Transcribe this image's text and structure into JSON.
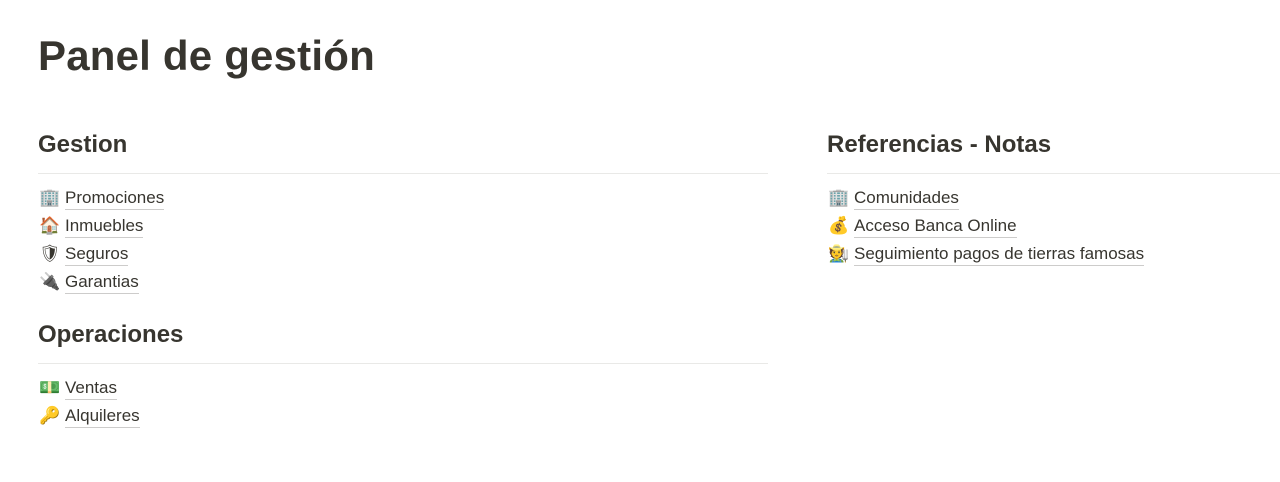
{
  "page": {
    "title": "Panel de gestión"
  },
  "left": {
    "sections": [
      {
        "heading": "Gestion",
        "items": [
          {
            "label": "Promociones",
            "icon": "office-building-icon",
            "glyph": "🏢"
          },
          {
            "label": "Inmuebles",
            "icon": "house-icon",
            "glyph": "🏠"
          },
          {
            "label": "Seguros",
            "icon": "shield-icon",
            "glyph": "🛡"
          },
          {
            "label": "Garantias",
            "icon": "plug-icon",
            "glyph": "🔌"
          }
        ]
      },
      {
        "heading": "Operaciones",
        "items": [
          {
            "label": "Ventas",
            "icon": "banknote-icon",
            "glyph": "💵"
          },
          {
            "label": "Alquileres",
            "icon": "key-icon",
            "glyph": "🔑"
          }
        ]
      }
    ]
  },
  "right": {
    "sections": [
      {
        "heading": "Referencias - Notas",
        "items": [
          {
            "label": "Comunidades",
            "icon": "office-building-icon",
            "glyph": "🏢"
          },
          {
            "label": "Acceso Banca Online",
            "icon": "money-bag-icon",
            "glyph": "💰"
          },
          {
            "label": "Seguimiento pagos de tierras famosas",
            "icon": "farmer-icon",
            "glyph": "🧑‍🌾"
          }
        ]
      }
    ]
  },
  "colors": {
    "text": "#37352f",
    "divider": "#e9e9e7",
    "background": "#ffffff"
  }
}
